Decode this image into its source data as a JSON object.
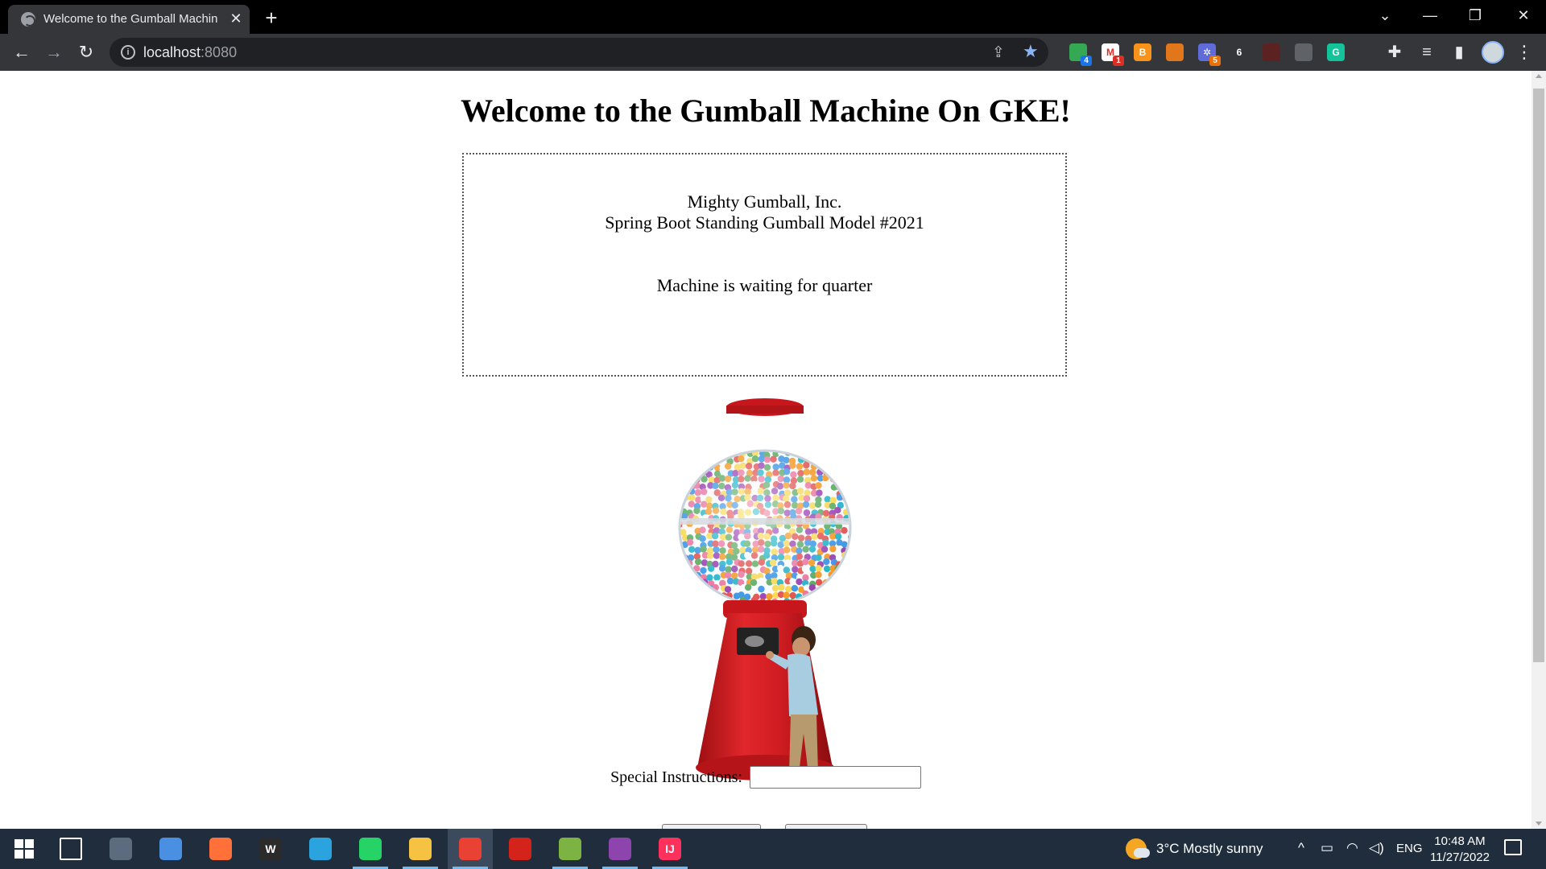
{
  "browser": {
    "tab_title": "Welcome to the Gumball Machin",
    "url_host": "localhost",
    "url_port": ":8080",
    "extensions": [
      {
        "name": "sheets-extension-icon",
        "letter": "",
        "color": "#34a853",
        "badge": "4",
        "badge_color": "#1a73e8"
      },
      {
        "name": "gmail-extension-icon",
        "letter": "M",
        "color": "#ffffff",
        "badge": "1",
        "badge_color": "#d93025"
      },
      {
        "name": "bitcoin-extension-icon",
        "letter": "B",
        "color": "#f7931a",
        "badge": "",
        "badge_color": ""
      },
      {
        "name": "metamask-extension-icon",
        "letter": "",
        "color": "#e2761b",
        "badge": "",
        "badge_color": ""
      },
      {
        "name": "flower-extension-icon",
        "letter": "✲",
        "color": "#5f6bd8",
        "badge": "5",
        "badge_color": "#e8710a"
      },
      {
        "name": "lock-extension-icon",
        "letter": "6",
        "color": "#35363a",
        "badge": "",
        "badge_color": ""
      },
      {
        "name": "pdf-extension-icon",
        "letter": "",
        "color": "#5c2222",
        "badge": "",
        "badge_color": ""
      },
      {
        "name": "grid-extension-icon",
        "letter": "",
        "color": "#5f6368",
        "badge": "",
        "badge_color": ""
      },
      {
        "name": "grammarly-extension-icon",
        "letter": "G",
        "color": "#15c39a",
        "badge": "",
        "badge_color": ""
      },
      {
        "name": "key-extension-icon",
        "letter": "",
        "color": "#35363a",
        "badge": "",
        "badge_color": ""
      }
    ]
  },
  "page": {
    "title": "Welcome to the Gumball Machine On GKE!",
    "company": "Mighty Gumball, Inc.",
    "model": "Spring Boot Standing Gumball Model #2021",
    "state": "Machine is waiting for quarter",
    "instructions_label": "Special Instructions:",
    "instructions_value": "",
    "machine_image_alt": "Gumball machine"
  },
  "taskbar": {
    "apps": [
      {
        "name": "task-view-icon",
        "label": "",
        "color": "transparent",
        "active": false
      },
      {
        "name": "calculator-app-icon",
        "label": "",
        "color": "#5c6b7d",
        "active": false
      },
      {
        "name": "chromium-app-icon",
        "label": "",
        "color": "#4a90e2",
        "active": false
      },
      {
        "name": "firefox-app-icon",
        "label": "",
        "color": "#ff7139",
        "active": false
      },
      {
        "name": "webstorm-app-icon",
        "label": "W",
        "color": "#2b2b2b",
        "active": false
      },
      {
        "name": "telegram-app-icon",
        "label": "",
        "color": "#2aa3df",
        "active": false
      },
      {
        "name": "whatsapp-app-icon",
        "label": "",
        "color": "#25d366",
        "active": false
      },
      {
        "name": "file-explorer-app-icon",
        "label": "",
        "color": "#f5c242",
        "active": false
      },
      {
        "name": "chrome-app-icon",
        "label": "",
        "color": "#e94235",
        "active": true
      },
      {
        "name": "acrobat-app-icon",
        "label": "",
        "color": "#d4231a",
        "active": false
      },
      {
        "name": "notepad-app-icon",
        "label": "",
        "color": "#7cb342",
        "active": false
      },
      {
        "name": "winrar-app-icon",
        "label": "",
        "color": "#8e44ad",
        "active": false
      },
      {
        "name": "intellij-app-icon",
        "label": "IJ",
        "color": "#fe315d",
        "active": false
      }
    ],
    "weather": "3°C  Mostly sunny",
    "language": "ENG",
    "time": "10:48 AM",
    "date": "11/27/2022"
  }
}
